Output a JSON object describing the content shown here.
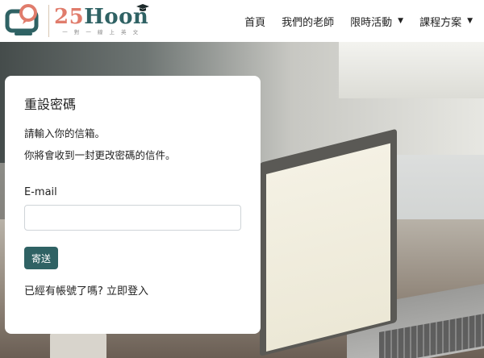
{
  "brand": {
    "number": "25",
    "name": "Hoon",
    "tagline": "一 對 一 線 上 英 文",
    "colors": {
      "number": "#e07c6c",
      "name": "#2f6264",
      "accent": "#2f6264"
    }
  },
  "nav": {
    "items": [
      {
        "label": "首頁",
        "has_caret": false
      },
      {
        "label": "我們的老師",
        "has_caret": false
      },
      {
        "label": "限時活動",
        "has_caret": true
      },
      {
        "label": "課程方案",
        "has_caret": true
      }
    ],
    "caret": "▼"
  },
  "reset_form": {
    "title": "重設密碼",
    "instruction": "請輸入你的信箱。",
    "instruction_detail": "你將會收到一封更改密碼的信件。",
    "email_label": "E-mail",
    "email_value": "",
    "email_placeholder": "",
    "submit_label": "寄送",
    "login_prompt": "已經有帳號了嗎?",
    "login_link": "立即登入"
  }
}
